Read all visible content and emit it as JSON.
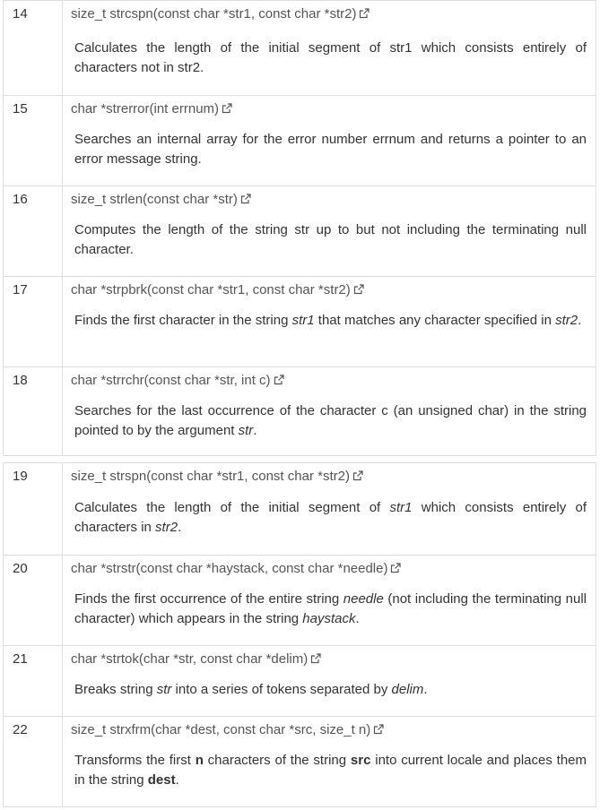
{
  "functions_top": [
    {
      "num": "14",
      "signature": "size_t strcspn(const char *str1, const char *str2)",
      "desc": [
        "Calculates the length of the initial segment of str1 which consists entirely of characters not in str2."
      ]
    },
    {
      "num": "15",
      "signature": "char *strerror(int errnum)",
      "desc": [
        "Searches an internal array for the error number errnum and returns a pointer to an error message string."
      ]
    },
    {
      "num": "16",
      "signature": "size_t strlen(const char *str)",
      "desc": [
        "Computes the length of the string str up to but not including the terminating null character."
      ]
    },
    {
      "num": "17",
      "signature": "char *strpbrk(const char *str1, const char *str2)",
      "desc": [
        "Finds the first character in the string ",
        "str1",
        " that matches any character specified in ",
        "str2",
        "."
      ]
    },
    {
      "num": "18",
      "signature": "char *strrchr(const char *str, int c)",
      "desc": [
        "Searches for the last occurrence of the character c (an unsigned char) in the string pointed to by the argument ",
        "str",
        "."
      ]
    }
  ],
  "functions_bottom": [
    {
      "num": "19",
      "signature": "size_t strspn(const char *str1, const char *str2)",
      "desc": [
        "Calculates the length of the initial segment of ",
        "str1",
        " which consists entirely of characters in ",
        "str2",
        "."
      ]
    },
    {
      "num": "20",
      "signature": "char *strstr(const char *haystack, const char *needle)",
      "desc": [
        "Finds the first occurrence of the entire string ",
        "needle",
        " (not including the terminating null character) which appears in the string ",
        "haystack",
        "."
      ]
    },
    {
      "num": "21",
      "signature": "char *strtok(char *str, const char *delim)",
      "desc": [
        "Breaks string ",
        "str",
        " into a series of tokens separated by ",
        "delim",
        "."
      ]
    },
    {
      "num": "22",
      "signature": "size_t strxfrm(char *dest, const char *src, size_t n)",
      "desc": [
        "Transforms the first ",
        "n",
        " characters of the string ",
        "src",
        " into current locale and places them in the string ",
        "dest",
        "."
      ]
    }
  ],
  "icons": {
    "link": "external-link-icon"
  },
  "colors": {
    "border": "#dedede",
    "text": "#333333",
    "signature": "#555555"
  }
}
